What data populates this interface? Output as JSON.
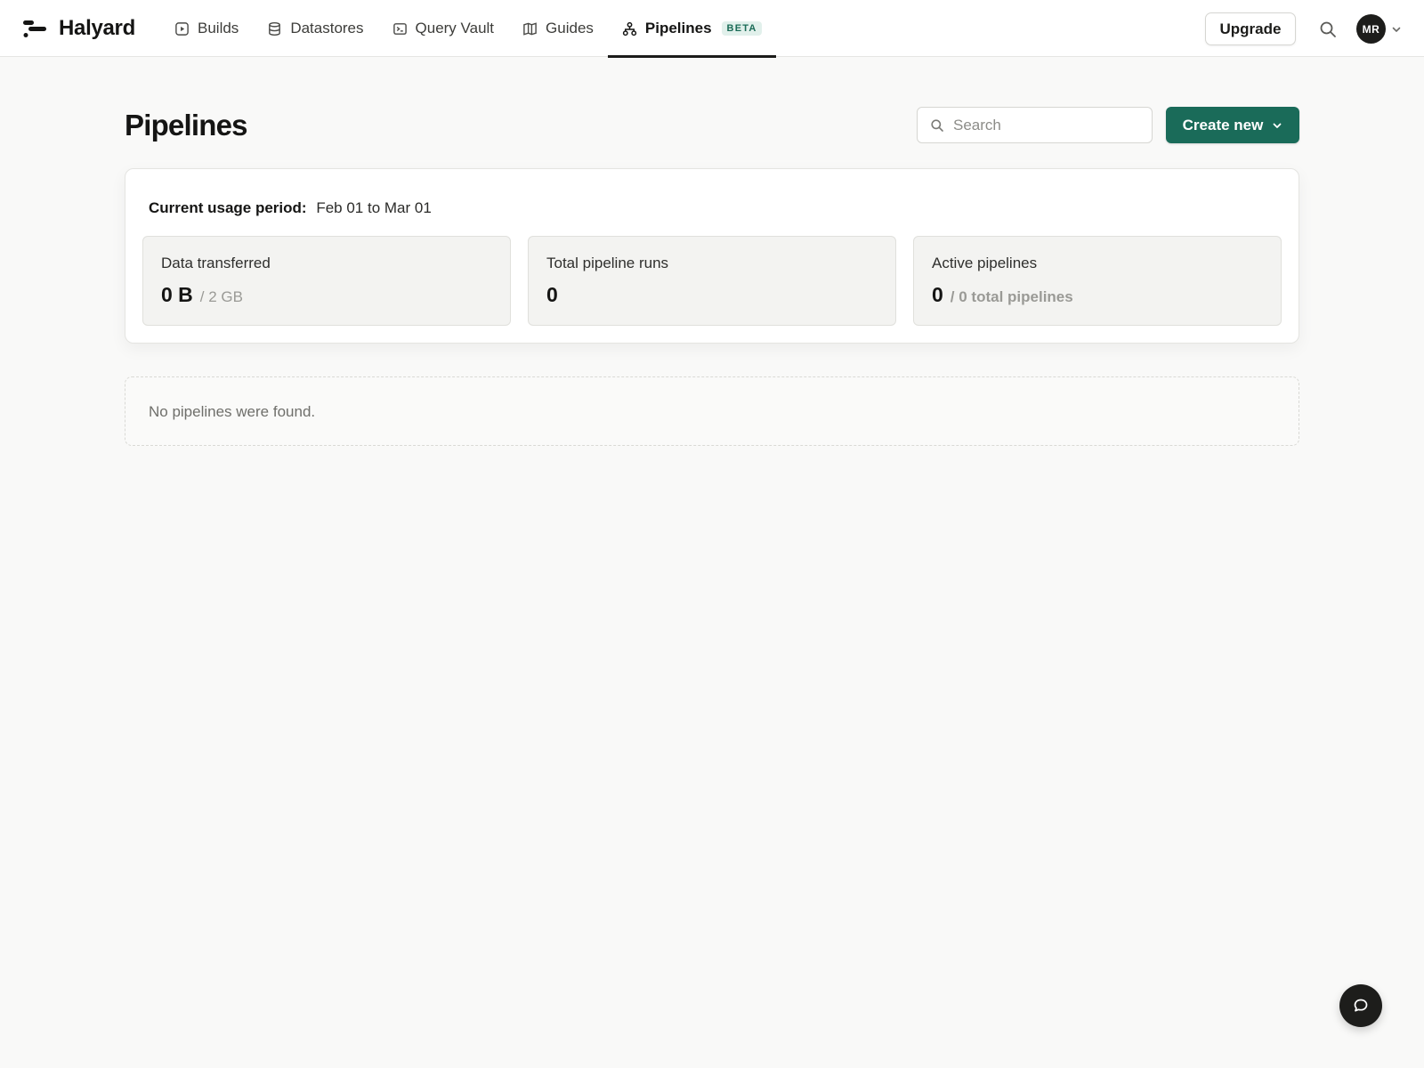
{
  "app": {
    "name": "Halyard"
  },
  "nav": {
    "items": [
      {
        "label": "Builds",
        "icon": "play-square-icon"
      },
      {
        "label": "Datastores",
        "icon": "database-icon"
      },
      {
        "label": "Query Vault",
        "icon": "terminal-icon"
      },
      {
        "label": "Guides",
        "icon": "book-icon"
      },
      {
        "label": "Pipelines",
        "icon": "pipeline-icon",
        "badge": "BETA",
        "active": true
      }
    ]
  },
  "header": {
    "upgrade_label": "Upgrade",
    "search_icon": "search-icon",
    "avatar_initials": "MR"
  },
  "page": {
    "title": "Pipelines",
    "search_placeholder": "Search",
    "create_label": "Create new"
  },
  "usage": {
    "period_label": "Current usage period:",
    "period_value": "Feb 01 to Mar 01",
    "stats": [
      {
        "label": "Data transferred",
        "value": "0 B",
        "sub": "/ 2 GB"
      },
      {
        "label": "Total pipeline runs",
        "value": "0",
        "sub": ""
      },
      {
        "label": "Active pipelines",
        "value": "0",
        "sub": "/ 0 total pipelines"
      }
    ]
  },
  "empty_state": {
    "message": "No pipelines were found."
  },
  "colors": {
    "accent": "#1a6b59",
    "beta_bg": "#e1f0eb",
    "beta_text": "#1b6b57",
    "page_bg": "#f9f9f8",
    "dark": "#1d1d1b"
  }
}
